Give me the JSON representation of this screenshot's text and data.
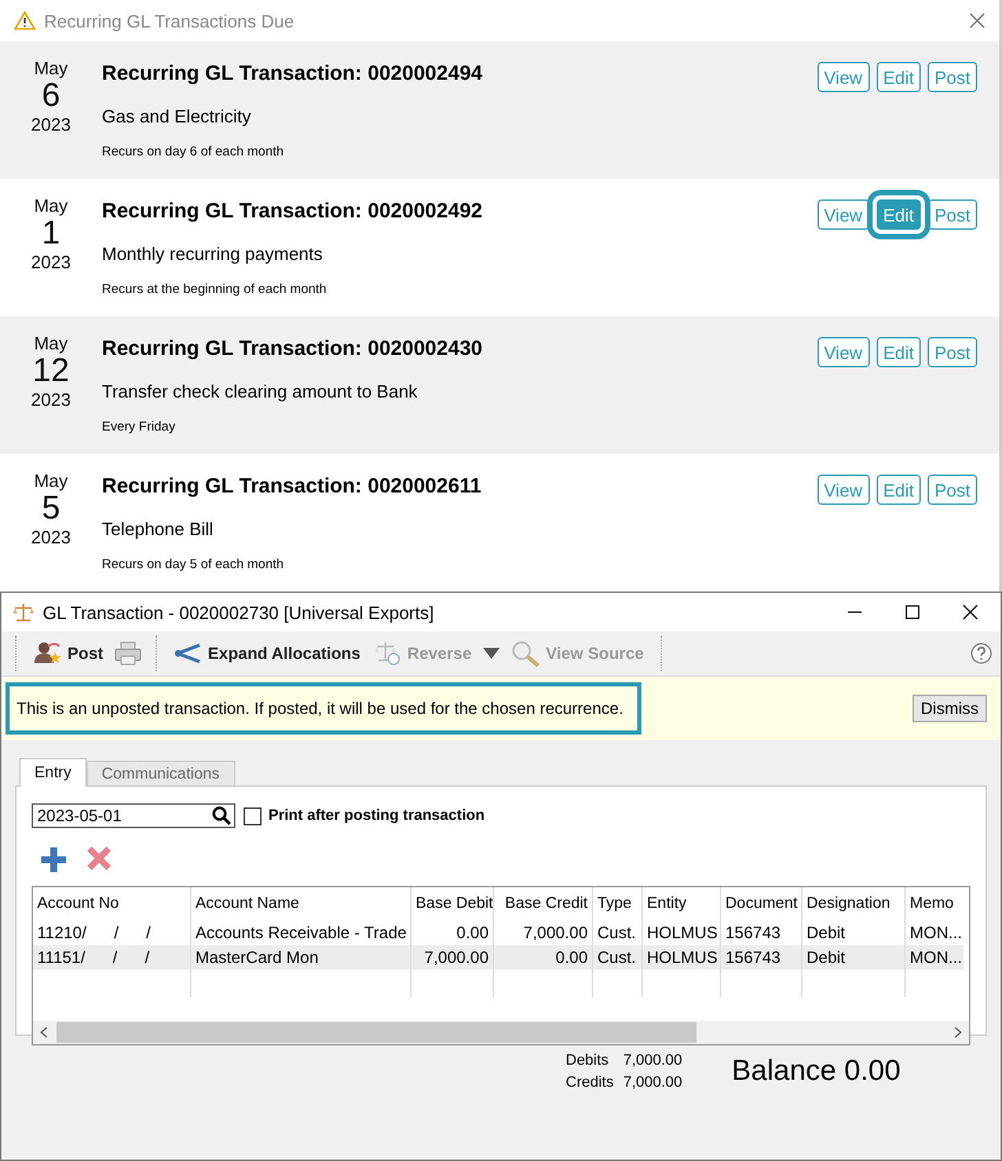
{
  "dialog": {
    "title": "Recurring GL Transactions Due",
    "items": [
      {
        "month": "May",
        "day": "6",
        "year": "2023",
        "title": "Recurring GL Transaction: 0020002494",
        "description": "Gas and Electricity",
        "recurrence": "Recurs on day 6 of each month",
        "buttons": [
          {
            "label": "View",
            "highlighted": false
          },
          {
            "label": "Edit",
            "highlighted": false
          },
          {
            "label": "Post",
            "highlighted": false
          }
        ]
      },
      {
        "month": "May",
        "day": "1",
        "year": "2023",
        "title": "Recurring GL Transaction: 0020002492",
        "description": "Monthly recurring payments",
        "recurrence": "Recurs at the beginning of each month",
        "buttons": [
          {
            "label": "View",
            "highlighted": false
          },
          {
            "label": "Edit",
            "highlighted": true
          },
          {
            "label": "Post",
            "highlighted": false
          }
        ]
      },
      {
        "month": "May",
        "day": "12",
        "year": "2023",
        "title": "Recurring GL Transaction: 0020002430",
        "description": "Transfer check clearing amount to Bank",
        "recurrence": "Every Friday",
        "buttons": [
          {
            "label": "View",
            "highlighted": false
          },
          {
            "label": "Edit",
            "highlighted": false
          },
          {
            "label": "Post",
            "highlighted": false
          }
        ]
      },
      {
        "month": "May",
        "day": "5",
        "year": "2023",
        "title": "Recurring GL Transaction: 0020002611",
        "description": "Telephone Bill",
        "recurrence": "Recurs on day 5 of each month",
        "buttons": [
          {
            "label": "View",
            "highlighted": false
          },
          {
            "label": "Edit",
            "highlighted": false
          },
          {
            "label": "Post",
            "highlighted": false
          }
        ]
      }
    ]
  },
  "gl_window": {
    "title": "GL Transaction - 0020002730 [Universal Exports]",
    "toolbar": [
      {
        "label": "Post",
        "disabled": false
      },
      {
        "label": "Expand Allocations",
        "disabled": false
      },
      {
        "label": "Reverse",
        "disabled": true
      },
      {
        "label": "View Source",
        "disabled": true
      }
    ],
    "notice": {
      "text": "This is an unposted transaction. If posted, it will be used for the chosen recurrence.",
      "highlighted": true,
      "button": "Dismiss"
    },
    "tabs": [
      {
        "label": "Entry",
        "selected": true
      },
      {
        "label": "Communications",
        "selected": false
      }
    ],
    "date": "2023-05-01",
    "print_after_posting": {
      "label": "Print after posting transaction",
      "checked": false
    },
    "table": {
      "columns": [
        "Account No",
        "Account Name",
        "Base Debit",
        "Base Credit",
        "Type",
        "Entity",
        "Document",
        "Designation",
        "Memo"
      ],
      "rows": [
        {
          "cells": [
            "11210/      /      /",
            "Accounts Receivable - Trade",
            "0.00",
            "7,000.00",
            "Cust.",
            "HOLMUS",
            "156743",
            "Debit",
            "MON..."
          ]
        },
        {
          "cells": [
            "11151/      /      /",
            "MasterCard Mon",
            "7,000.00",
            "0.00",
            "Cust.",
            "HOLMUS",
            "156743",
            "Debit",
            "MON..."
          ]
        }
      ]
    },
    "totals": {
      "debits_label": "Debits",
      "debits": "7,000.00",
      "credits_label": "Credits",
      "credits": "7,000.00",
      "balance": "Balance 0.00"
    }
  }
}
